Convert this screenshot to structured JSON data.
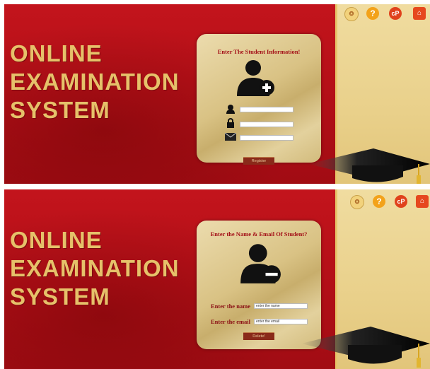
{
  "brand": {
    "title_lines": [
      "ONLINE",
      "EXAMINATION",
      "SYSTEM"
    ]
  },
  "toolbar_icons": [
    "certificate-icon",
    "help-icon",
    "cp-icon",
    "home-icon"
  ],
  "register_panel": {
    "heading": "Enter The Student Information!",
    "fields": [
      "username-field",
      "password-field",
      "email-field"
    ],
    "button_label": "Register"
  },
  "delete_panel": {
    "heading": "Enter the Name & Email Of Student?",
    "name_label": "Enter the name",
    "name_placeholder": "enter the name",
    "email_label": "Enter the email",
    "email_placeholder": "enter the email",
    "button_label": "Delete!"
  },
  "colors": {
    "background_red": "#b8121a",
    "title_gold": "#e6c16a",
    "sidebar_gold": "#ecd595",
    "heading_red": "#a30f17",
    "button_brown": "#8a2a1a"
  }
}
